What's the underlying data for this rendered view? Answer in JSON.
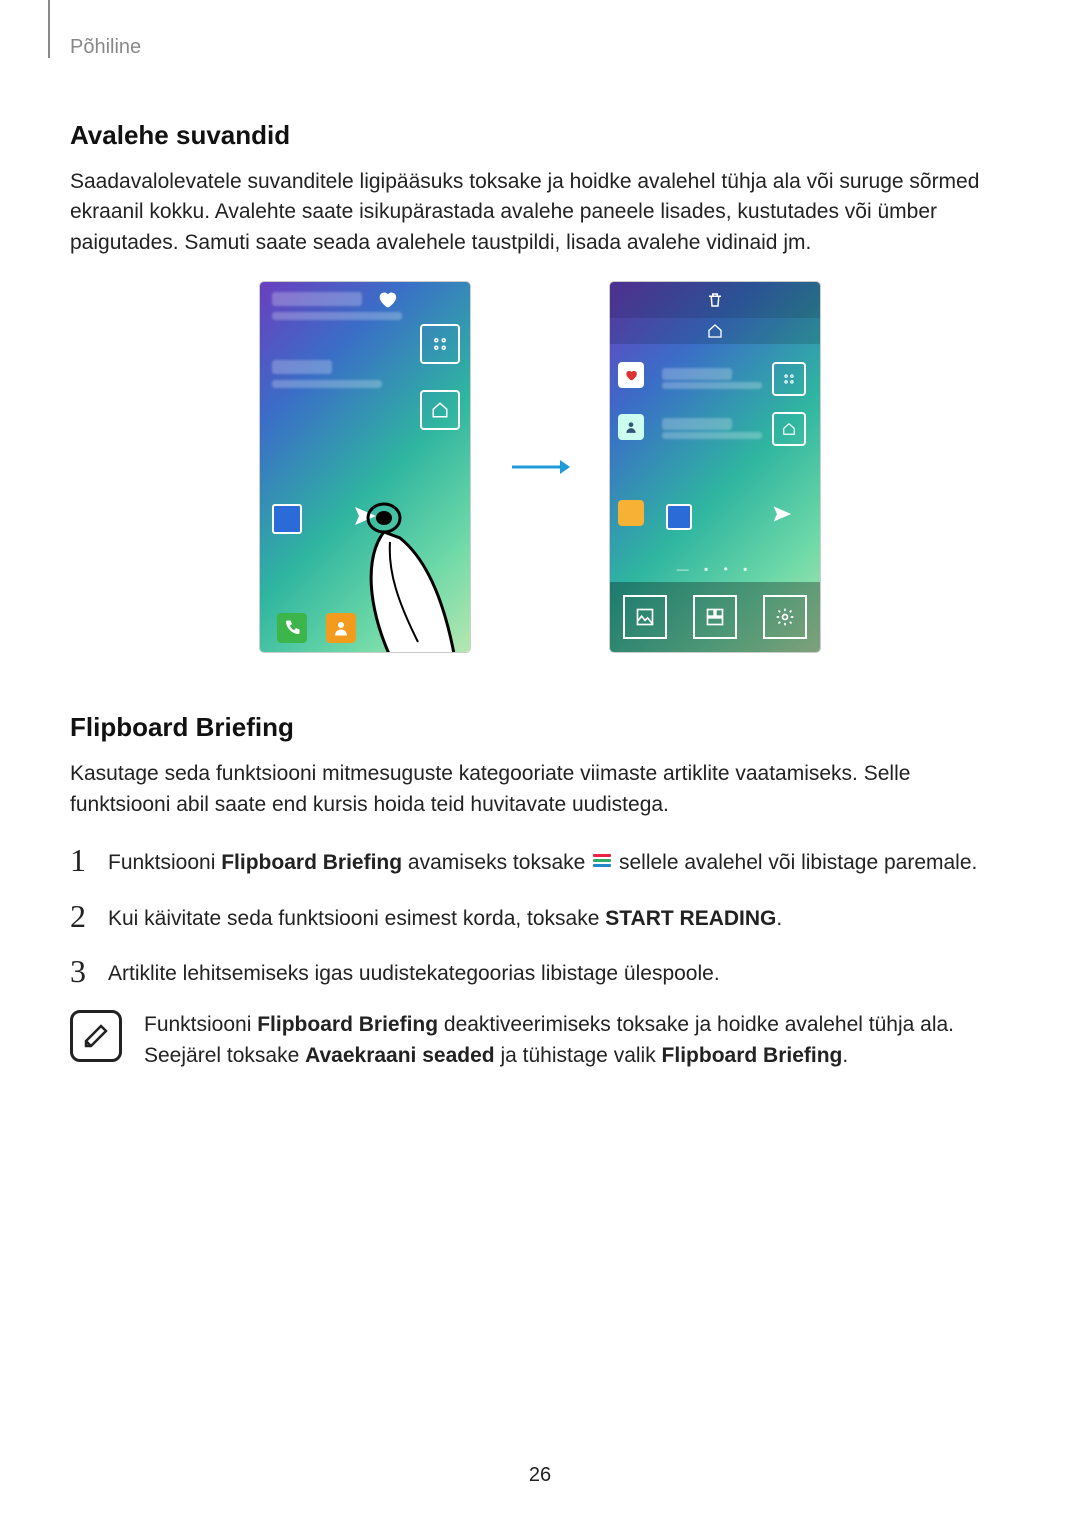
{
  "header": {
    "section_label": "Põhiline"
  },
  "section_options": {
    "heading": "Avalehe suvandid",
    "body": "Saadavalolevatele suvanditele ligipääsuks toksake ja hoidke avalehel tühja ala või suruge sõrmed ekraanil kokku. Avalehte saate isikupärastada avalehe paneele lisades, kustutades või ümber paigutades. Samuti saate seada avalehele taustpildi, lisada avalehe vidinaid jm."
  },
  "section_flipboard": {
    "heading": "Flipboard Briefing",
    "intro": "Kasutage seda funktsiooni mitmesuguste kategooriate viimaste artiklite vaatamiseks. Selle funktsiooni abil saate end kursis hoida teid huvitavate uudistega.",
    "steps": {
      "s1_pre": "Funktsiooni ",
      "s1_bold": "Flipboard Briefing",
      "s1_mid": " avamiseks toksake ",
      "s1_post": " sellele avalehel või libistage paremale.",
      "s2_pre": "Kui käivitate seda funktsiooni esimest korda, toksake ",
      "s2_bold": "START READING",
      "s2_post": ".",
      "s3": "Artiklite lehitsemiseks igas uudistekategoorias libistage ülespoole."
    },
    "note": {
      "line1_pre": "Funktsiooni ",
      "line1_bold": "Flipboard Briefing",
      "line1_post": " deaktiveerimiseks toksake ja hoidke avalehel tühja ala. ",
      "line2_pre": "Seejärel toksake ",
      "line2_bold1": "Avaekraani seaded",
      "line2_mid": " ja tühistage valik ",
      "line2_bold2": "Flipboard Briefing",
      "line2_post": "."
    }
  },
  "page_number": "26"
}
